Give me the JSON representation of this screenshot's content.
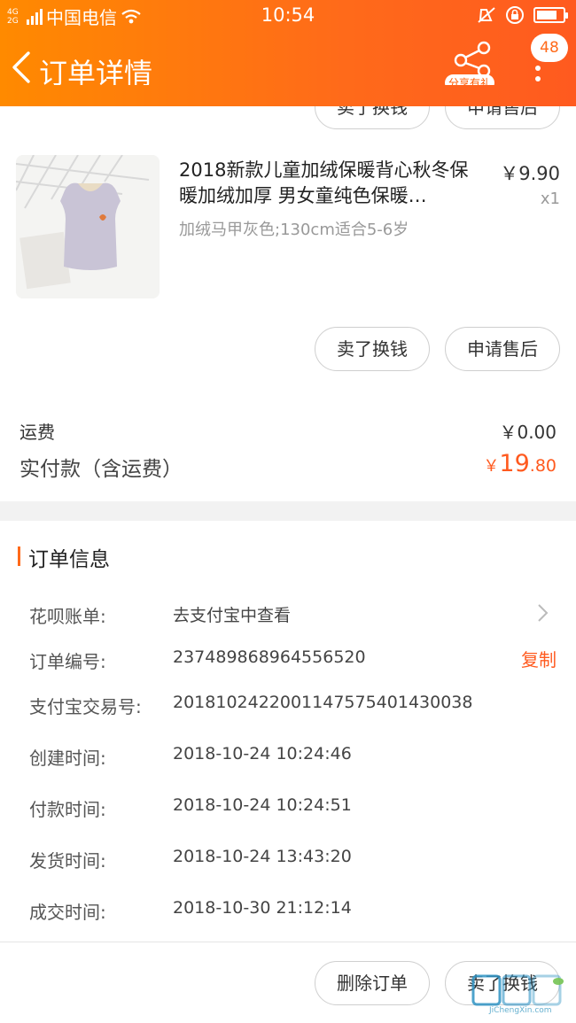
{
  "status_bar": {
    "network": "4G",
    "network2": "2G",
    "carrier": "中国电信",
    "time": "10:54"
  },
  "nav": {
    "title": "订单详情",
    "share_badge": "分享有礼",
    "message_count": "48"
  },
  "top_buttons": {
    "sell": "卖了换钱",
    "after_sale": "申请售后"
  },
  "product": {
    "title": "2018新款儿童加绒保暖背心秋冬保暖加绒加厚 男女童纯色保暖…",
    "sku": "加绒马甲灰色;130cm适合5-6岁",
    "price": "￥9.90",
    "quantity": "x1"
  },
  "product_buttons": {
    "sell": "卖了换钱",
    "after_sale": "申请售后"
  },
  "totals": {
    "shipping_label": "运费",
    "shipping_value": "￥0.00",
    "paid_label": "实付款（含运费）",
    "paid_currency": "￥",
    "paid_integer": "19",
    "paid_decimal": ".80"
  },
  "order_info": {
    "title": "订单信息",
    "rows": [
      {
        "label": "花呗账单:",
        "value": "去支付宝中查看"
      },
      {
        "label": "订单编号:",
        "value": "237489868964556520",
        "action": "复制"
      },
      {
        "label": "支付宝交易号:",
        "value": "2018102422001147575401430038"
      },
      {
        "label": "创建时间:",
        "value": "2018-10-24 10:24:46"
      },
      {
        "label": "付款时间:",
        "value": "2018-10-24 10:24:51"
      },
      {
        "label": "发货时间:",
        "value": "2018-10-24 13:43:20"
      },
      {
        "label": "成交时间:",
        "value": "2018-10-30 21:12:14"
      }
    ]
  },
  "bottom_bar": {
    "delete": "删除订单",
    "sell": "卖了换钱"
  },
  "watermark": {
    "text": "JiChengXin.com"
  },
  "colors": {
    "accent": "#ff6a1a",
    "price": "#ff5a1f"
  }
}
